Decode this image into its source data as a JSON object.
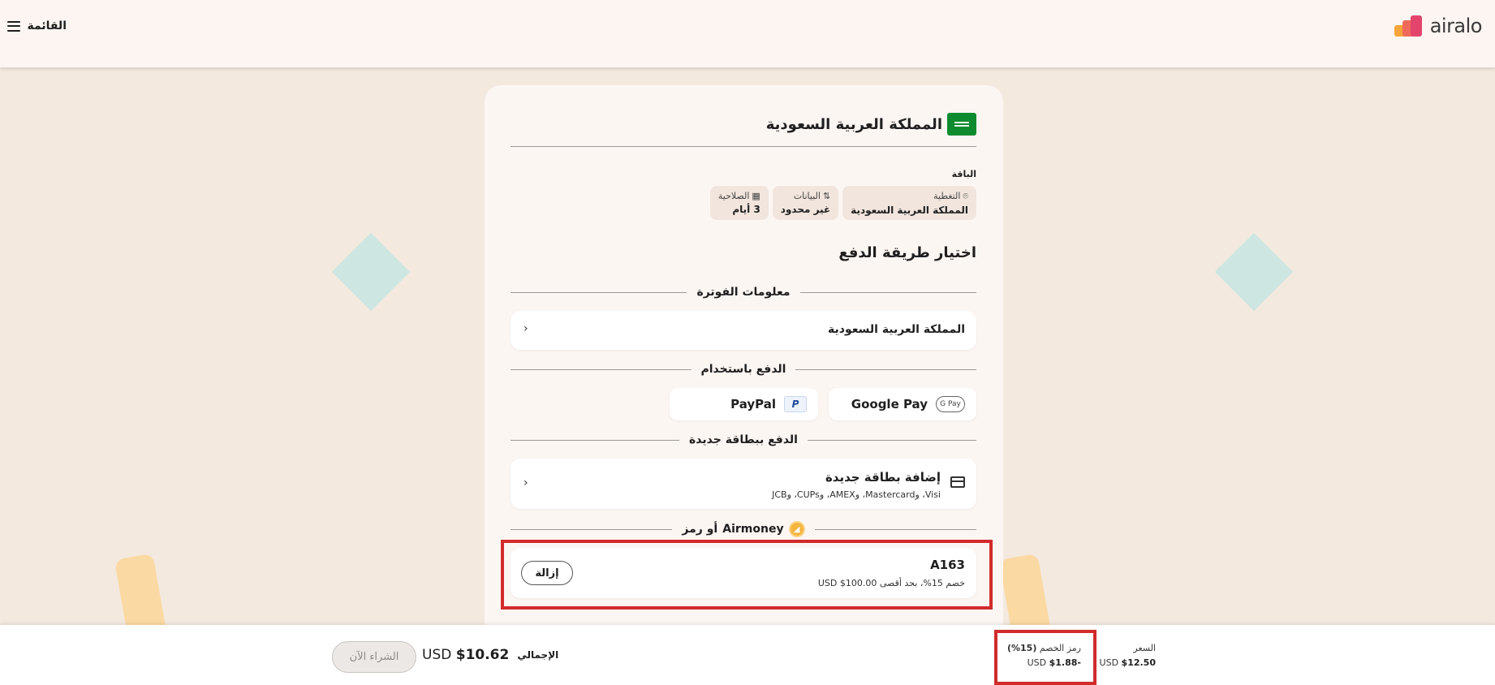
{
  "header": {
    "menu_label": "القائمة",
    "logo_text": "airalo"
  },
  "card": {
    "country": "المملكة العربية السعودية",
    "package_label": "الباقة",
    "chips": [
      {
        "label": "التغطية",
        "value": "المملكة العربية السعودية",
        "icon": "location-pin-icon"
      },
      {
        "label": "البيانات",
        "value": "غير محدود",
        "icon": "data-arrows-icon"
      },
      {
        "label": "الصلاحية",
        "value": "3 أيام",
        "icon": "calendar-icon"
      }
    ],
    "payment_title": "اختيار طريقة الدفع",
    "billing_divider": "معلومات الفوترة",
    "billing_value": "المملكة العربية السعودية",
    "pay_with_divider": "الدفع باستخدام",
    "google_pay": "Google Pay",
    "google_pay_icon_text": "G Pay",
    "paypal": "PayPal",
    "paypal_icon_text": "P",
    "new_card_divider": "الدفع ببطاقة جديدة",
    "add_card_title": "إضافة بطاقة جديدة",
    "add_card_subtitle": "Visi، وMastercard، وAMEX، وCUPs، وJCB",
    "airmoney_divider_brand": "Airmoney",
    "airmoney_divider_suffix": "أو رمز",
    "promo": {
      "code": "A163",
      "description": "خصم 15%، بحد أقصى 100.00$ USD",
      "remove_label": "إزالة"
    }
  },
  "footer": {
    "price_label": "السعر",
    "price_value": "$12.50",
    "currency": "USD",
    "discount_label": "رمز الخصم",
    "discount_percent": "(15%)",
    "discount_value": "-$1.88",
    "total_label": "الإجمالي",
    "total_value": "$10.62",
    "buy_label": "الشراء الآن"
  },
  "colors": {
    "background": "#f3e9df",
    "card": "#fcf6f3",
    "highlight": "#d12b2b",
    "flag_green": "#0f8b2f"
  }
}
